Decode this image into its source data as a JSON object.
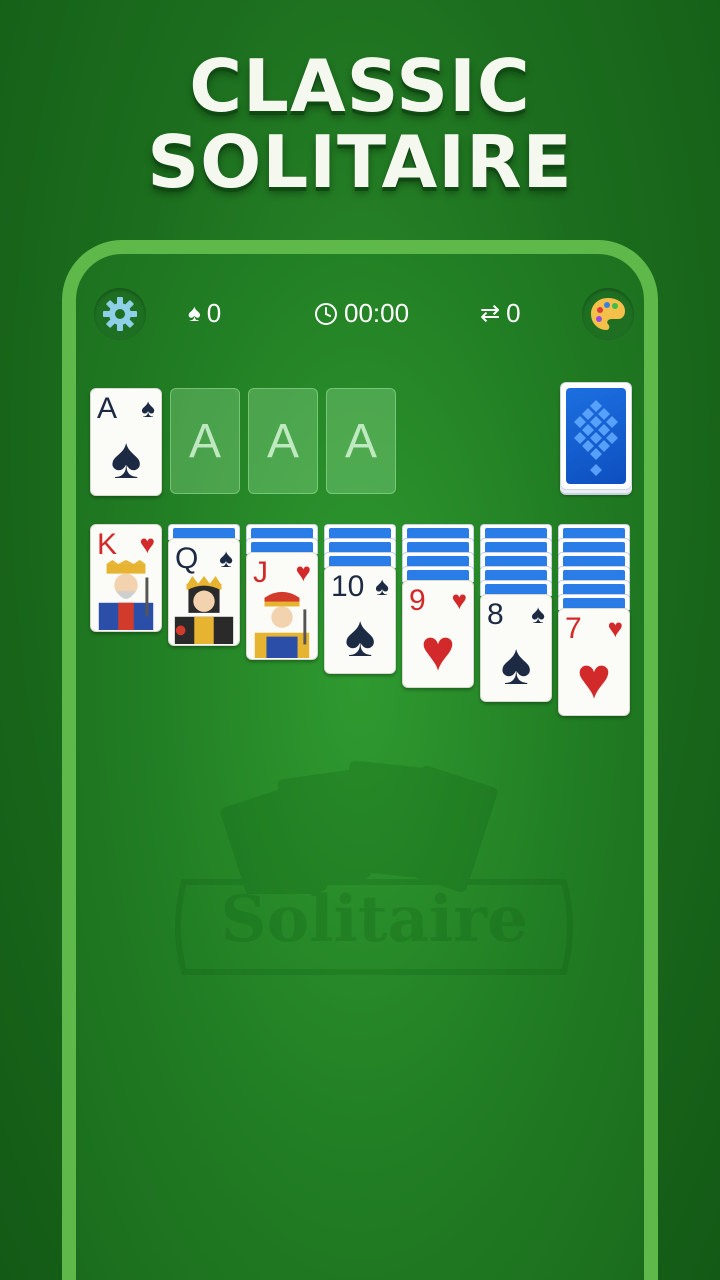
{
  "promo": {
    "line1": "CLASSIC",
    "line2": "SOLITAIRE"
  },
  "topbar": {
    "settings_icon": "gear-icon",
    "score": "0",
    "score_icon": "spade-icon",
    "timer": "00:00",
    "timer_icon": "clock-icon",
    "moves": "0",
    "moves_icon": "swap-arrows-icon",
    "theme_icon": "palette-icon"
  },
  "foundations": [
    {
      "rank": "A",
      "suit": "♠",
      "color": "black",
      "filled": true
    },
    {
      "label": "A",
      "filled": false
    },
    {
      "label": "A",
      "filled": false
    },
    {
      "label": "A",
      "filled": false
    }
  ],
  "tableau": [
    {
      "facedown": 0,
      "rank": "K",
      "suit": "♥",
      "color": "red",
      "face": true
    },
    {
      "facedown": 1,
      "rank": "Q",
      "suit": "♠",
      "color": "black",
      "face": true
    },
    {
      "facedown": 2,
      "rank": "J",
      "suit": "♥",
      "color": "red",
      "face": true
    },
    {
      "facedown": 3,
      "rank": "10",
      "suit": "♠",
      "color": "black",
      "face": false
    },
    {
      "facedown": 4,
      "rank": "9",
      "suit": "♥",
      "color": "red",
      "face": false
    },
    {
      "facedown": 5,
      "rank": "8",
      "suit": "♠",
      "color": "black",
      "face": false
    },
    {
      "facedown": 6,
      "rank": "7",
      "suit": "♥",
      "color": "red",
      "face": false
    }
  ],
  "watermark": {
    "text": "Solitaire"
  },
  "colors": {
    "accent": "#5fb84a",
    "felt": "#217d23",
    "card_back": "#1c6fe0",
    "red_suit": "#d22a2a",
    "black_suit": "#1d2a44"
  }
}
